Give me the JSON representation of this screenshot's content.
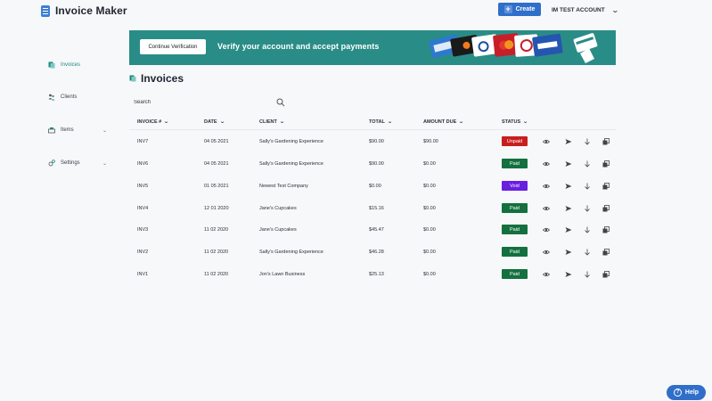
{
  "app": {
    "title": "Invoice Maker"
  },
  "header": {
    "create_label": "Create",
    "account_label": "IM TEST ACCOUNT"
  },
  "sidebar": {
    "items": [
      {
        "label": "Invoices",
        "active": true
      },
      {
        "label": "Clients"
      },
      {
        "label": "Items"
      },
      {
        "label": "Settings"
      }
    ]
  },
  "banner": {
    "button_label": "Continue Verification",
    "text": "Verify your account and accept payments"
  },
  "page": {
    "title": "Invoices"
  },
  "search": {
    "placeholder": "Search"
  },
  "table": {
    "columns": [
      "INVOICE #",
      "DATE",
      "CLIENT",
      "TOTAL",
      "AMOUNT DUE",
      "STATUS"
    ],
    "rows": [
      {
        "invoice": "INV7",
        "date": "04 05 2021",
        "client": "Sally's Gardening Experience",
        "total": "$90.00",
        "due": "$90.00",
        "status": "Unpaid"
      },
      {
        "invoice": "INV6",
        "date": "04 05 2021",
        "client": "Sally's Gardening Experience",
        "total": "$90.00",
        "due": "$0.00",
        "status": "Paid"
      },
      {
        "invoice": "INV5",
        "date": "01 05 2021",
        "client": "Newest Test Company",
        "total": "$0.00",
        "due": "$0.00",
        "status": "Void"
      },
      {
        "invoice": "INV4",
        "date": "12 01 2020",
        "client": "Jane's Cupcakes",
        "total": "$15.16",
        "due": "$0.00",
        "status": "Paid"
      },
      {
        "invoice": "INV3",
        "date": "11 02 2020",
        "client": "Jane's Cupcakes",
        "total": "$45.47",
        "due": "$0.00",
        "status": "Paid"
      },
      {
        "invoice": "INV2",
        "date": "11 02 2020",
        "client": "Sally's Gardening Experience",
        "total": "$46.28",
        "due": "$0.00",
        "status": "Paid"
      },
      {
        "invoice": "INV1",
        "date": "11 02 2020",
        "client": "Jon's Lawn Business",
        "total": "$25.13",
        "due": "$0.00",
        "status": "Paid"
      }
    ]
  },
  "status_colors": {
    "Unpaid": "#c81e1e",
    "Paid": "#14703f",
    "Void": "#6a1ee0"
  },
  "colors": {
    "accent": "#2f6fc9",
    "banner": "#2a8c86",
    "active": "#1e8a7f"
  },
  "icons": {
    "row_actions": [
      "eye-icon",
      "send-icon",
      "download-icon",
      "duplicate-icon"
    ],
    "banner_cards": [
      "american-express-card",
      "discover-card",
      "diners-club-card",
      "mastercard-card",
      "visa-card",
      "credit-card-hand"
    ]
  },
  "help": {
    "label": "Help"
  }
}
